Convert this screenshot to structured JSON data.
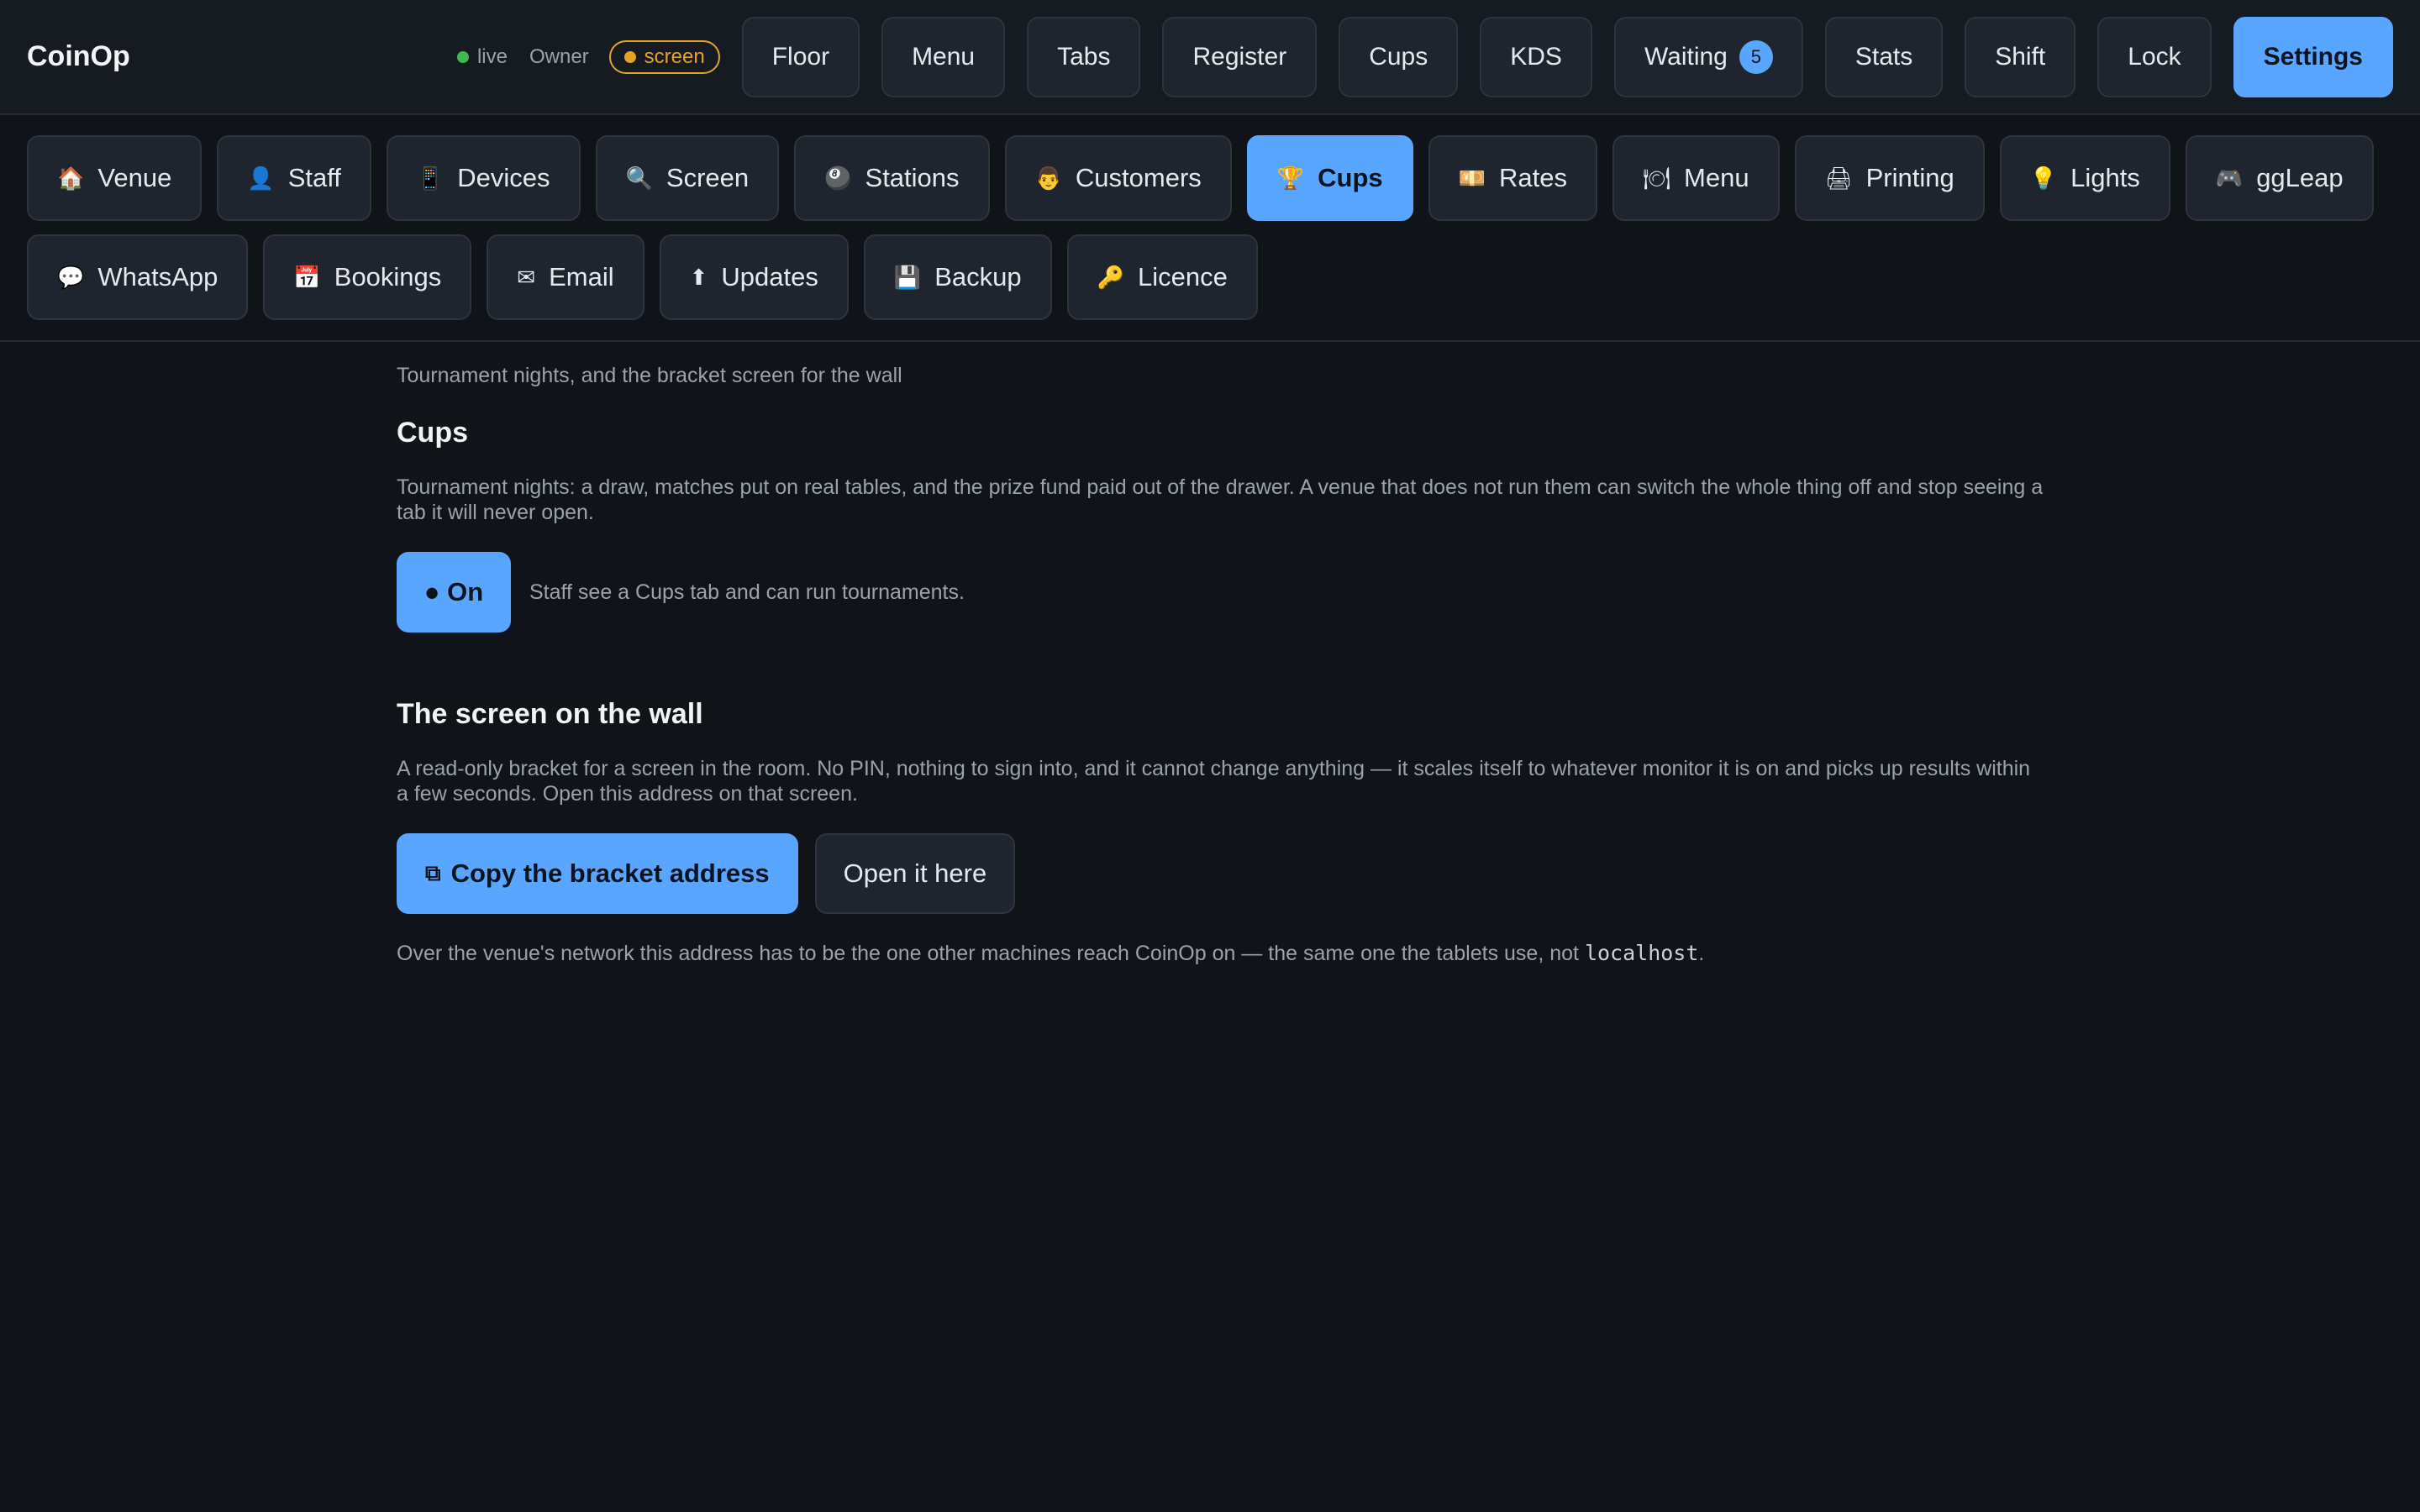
{
  "app": {
    "title": "CoinOp"
  },
  "status": {
    "live_label": "live",
    "role": "Owner",
    "mode_pill": "screen"
  },
  "nav": {
    "items": [
      {
        "label": "Floor"
      },
      {
        "label": "Menu"
      },
      {
        "label": "Tabs"
      },
      {
        "label": "Register"
      },
      {
        "label": "Cups"
      },
      {
        "label": "KDS"
      },
      {
        "label": "Waiting",
        "badge": "5"
      },
      {
        "label": "Stats"
      },
      {
        "label": "Shift"
      },
      {
        "label": "Lock"
      },
      {
        "label": "Settings",
        "active": true
      }
    ]
  },
  "settings_tabs": {
    "row1": [
      {
        "icon": "🏠",
        "icon_name": "house-icon",
        "label": "Venue"
      },
      {
        "icon": "👤",
        "icon_name": "person-icon",
        "label": "Staff"
      },
      {
        "icon": "📱",
        "icon_name": "phone-icon",
        "label": "Devices"
      },
      {
        "icon": "🔍",
        "icon_name": "magnifier-icon",
        "label": "Screen"
      },
      {
        "icon": "🎱",
        "icon_name": "pool-ball-icon",
        "label": "Stations"
      },
      {
        "icon": "👨",
        "icon_name": "face-icon",
        "label": "Customers"
      },
      {
        "icon": "🏆",
        "icon_name": "trophy-icon",
        "label": "Cups",
        "active": true
      },
      {
        "icon": "💴",
        "icon_name": "banknote-icon",
        "label": "Rates"
      },
      {
        "icon": "🍽",
        "icon_name": "plate-icon",
        "label": "Menu"
      },
      {
        "icon": "🖨",
        "icon_name": "printer-icon",
        "label": "Printing"
      },
      {
        "icon": "💡",
        "icon_name": "bulb-icon",
        "label": "Lights"
      },
      {
        "icon": "🎮",
        "icon_name": "gamepad-icon",
        "label": "ggLeap"
      }
    ],
    "row2": [
      {
        "icon": "💬",
        "icon_name": "speech-bubble-icon",
        "label": "WhatsApp"
      },
      {
        "icon": "📅",
        "icon_name": "calendar-icon",
        "label": "Bookings"
      },
      {
        "icon": "✉",
        "icon_name": "envelope-icon",
        "label": "Email"
      },
      {
        "icon": "⬆",
        "icon_name": "up-arrow-icon",
        "label": "Updates"
      },
      {
        "icon": "💾",
        "icon_name": "floppy-disk-icon",
        "label": "Backup"
      },
      {
        "icon": "🔑",
        "icon_name": "key-icon",
        "label": "Licence"
      }
    ]
  },
  "page": {
    "intro": "Tournament nights, and the bracket screen for the wall",
    "cups": {
      "heading": "Cups",
      "description": "Tournament nights: a draw, matches put on real tables, and the prize fund paid out of the drawer. A venue that does not run them can switch the whole thing off and stop seeing a tab it will never open.",
      "toggle_label": "● On",
      "toggle_note": "Staff see a Cups tab and can run tournaments."
    },
    "wall": {
      "heading": "The screen on the wall",
      "description": "A read-only bracket for a screen in the room. No PIN, nothing to sign into, and it cannot change anything — it scales itself to whatever monitor it is on and picks up results within a few seconds. Open this address on that screen.",
      "copy_icon": "⧉",
      "copy_label": "Copy the bracket address",
      "open_label": "Open it here",
      "footnote_before": "Over the venue's network this address has to be the one other machines reach CoinOp on — the same one the tablets use, not ",
      "footnote_code": "localhost",
      "footnote_after": "."
    }
  },
  "colors": {
    "accent": "#58a6ff",
    "live": "#3fb950",
    "warning": "#e3a32a",
    "background": "#101418"
  }
}
